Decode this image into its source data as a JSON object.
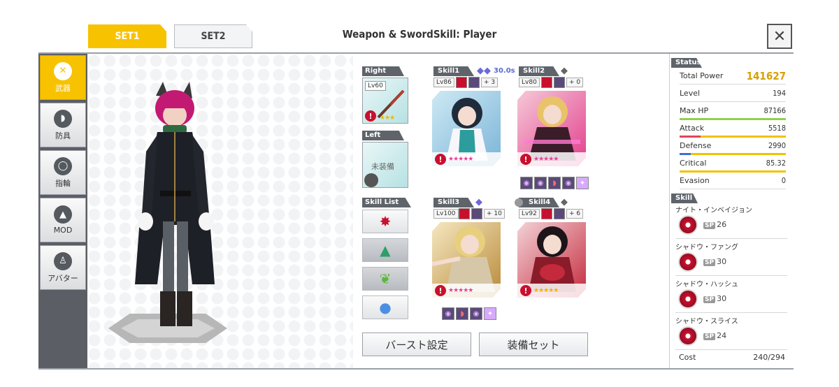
{
  "tabs": {
    "set1": "SET1",
    "set2": "SET2"
  },
  "title": "Weapon & SwordSkill: Player",
  "close_icon": "close-icon",
  "sidebar": {
    "items": [
      {
        "label": "武器",
        "icon": "swords-icon",
        "active": true
      },
      {
        "label": "防具",
        "icon": "shield-icon",
        "active": false
      },
      {
        "label": "指輪",
        "icon": "ring-icon",
        "active": false
      },
      {
        "label": "MOD",
        "icon": "mod-icon",
        "active": false
      },
      {
        "label": "アバター",
        "icon": "avatar-icon",
        "active": false
      }
    ]
  },
  "equipment": {
    "right_label": "Right",
    "right_level": "Lv60",
    "left_label": "Left",
    "left_status": "未装備",
    "skill_list_label": "Skill List"
  },
  "skills": [
    {
      "tab": "Skill1",
      "level": "Lv86",
      "plus": "+ 3",
      "timer": "30.0s",
      "stars": "★★★★★"
    },
    {
      "tab": "Skill2",
      "level": "Lv80",
      "plus": "+ 0",
      "timer": "",
      "stars": "★★★★★"
    },
    {
      "tab": "Skill3",
      "level": "Lv100",
      "plus": "+ 10",
      "timer": "",
      "stars": "★★★★★"
    },
    {
      "tab": "Skill4",
      "level": "Lv92",
      "plus": "+ 6",
      "timer": "",
      "stars": "★★★★★"
    }
  ],
  "buttons": {
    "burst": "バースト設定",
    "equip_set": "装備セット"
  },
  "status": {
    "header": "Status",
    "total_power_label": "Total Power",
    "total_power": "141627",
    "rows": [
      {
        "label": "Level",
        "value": "194"
      },
      {
        "label": "Max HP",
        "value": "87166"
      },
      {
        "label": "Attack",
        "value": "5518"
      },
      {
        "label": "Defense",
        "value": "2990"
      },
      {
        "label": "Critical",
        "value": "85.32"
      },
      {
        "label": "Evasion",
        "value": "0"
      }
    ],
    "colors": {
      "hp": "#8fd14f",
      "attack": "#e0455b",
      "defense": "#3d6fd6",
      "critical": "#f2c200"
    }
  },
  "skill_panel": {
    "header": "Skill",
    "items": [
      {
        "name": "ナイト・インベイジョン",
        "sp": "26"
      },
      {
        "name": "シャドウ・ファング",
        "sp": "30"
      },
      {
        "name": "シャドウ・ハッシュ",
        "sp": "30"
      },
      {
        "name": "シャドウ・スライス",
        "sp": "24"
      }
    ],
    "sp_prefix": "SP",
    "cost_label": "Cost",
    "cost_value": "240/294"
  }
}
